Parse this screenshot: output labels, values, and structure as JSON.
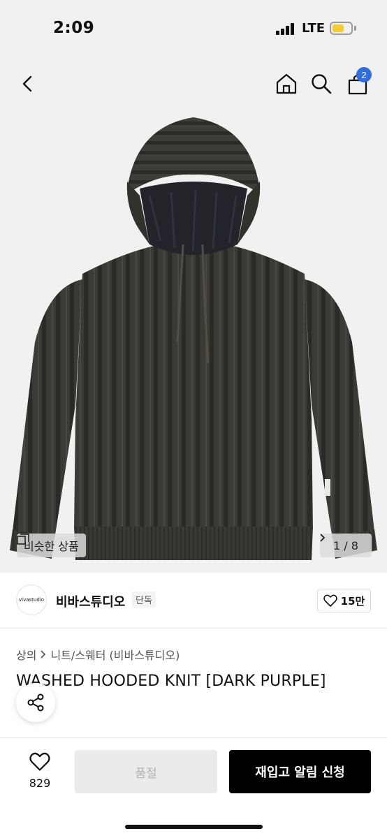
{
  "status_bar": {
    "time": "2:09",
    "network": "LTE"
  },
  "header": {
    "cart_count": "2",
    "icons": [
      "back-icon",
      "home-icon",
      "search-icon",
      "cart-icon"
    ]
  },
  "gallery": {
    "similar_label": "비슷한 상품",
    "page_indicator": "1 / 8",
    "image_subject": "dark ribbed knit hoodie"
  },
  "brand": {
    "logo_text": "vivastudio",
    "name": "비바스튜디오",
    "tag": "단독",
    "likes": "15만"
  },
  "breadcrumb": {
    "category": "상의",
    "subcategory": "니트/스웨터 (비바스튜디오)"
  },
  "product": {
    "title": "WASHED HOODED KNIT [DARK PURPLE]"
  },
  "bottom_bar": {
    "wish_count": "829",
    "soldout_label": "품절",
    "restock_label": "재입고 알림 신청"
  },
  "colors": {
    "background": "#f1f1f1",
    "accent": "#2f6de1",
    "battery": "#f5cd2f",
    "primary_button": "#000000",
    "disabled_button": "#ebebeb"
  }
}
